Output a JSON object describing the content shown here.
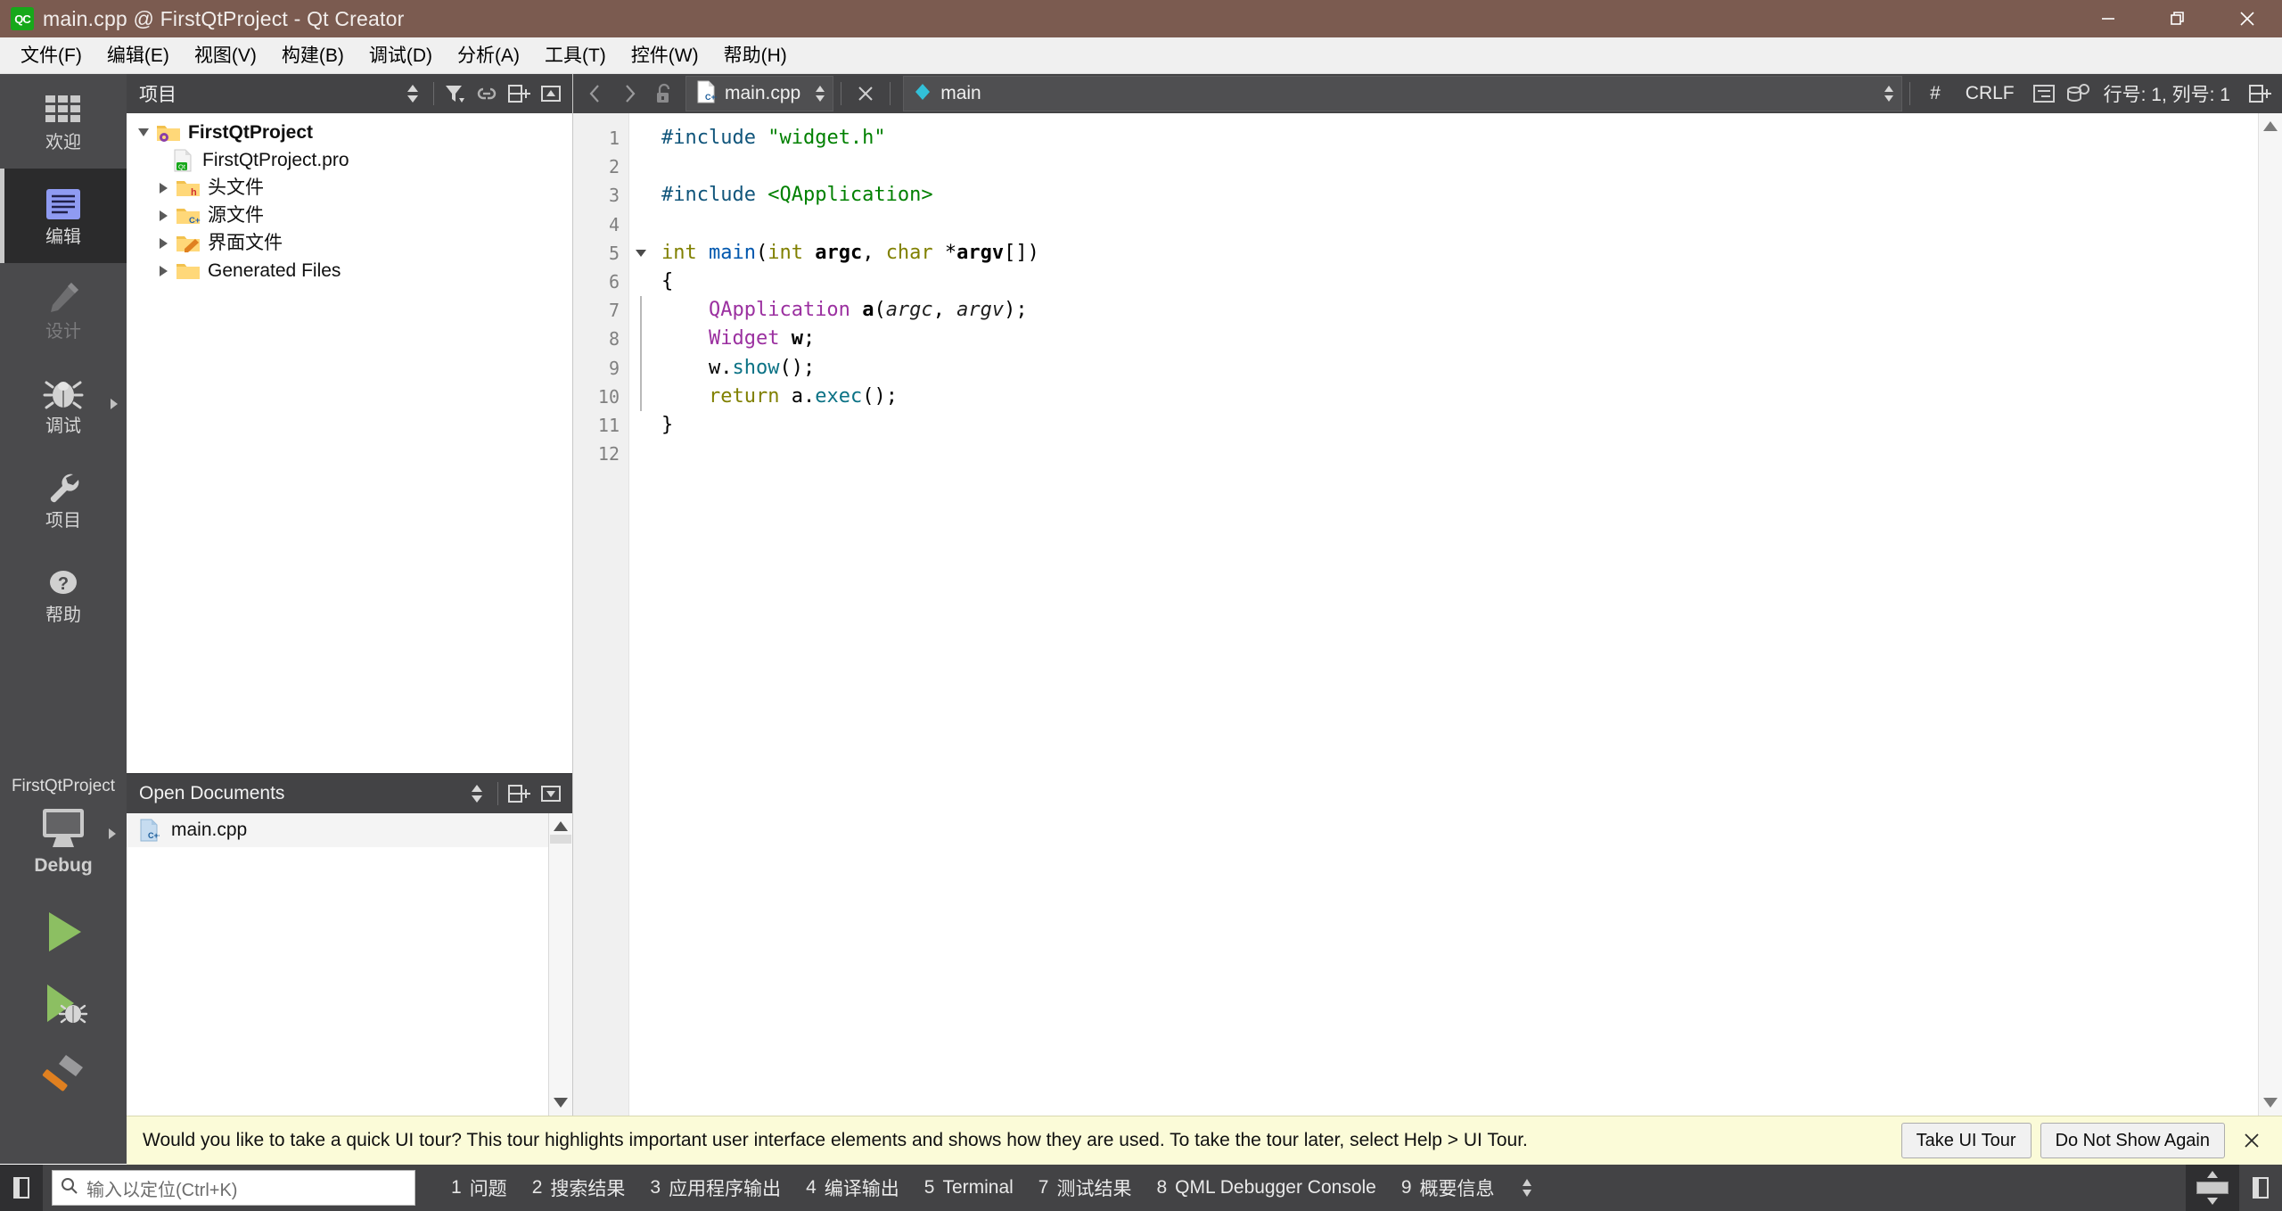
{
  "window": {
    "logo_text": "QC",
    "title": "main.cpp @ FirstQtProject - Qt Creator",
    "controls": {
      "minimize": "minimize-icon",
      "restore": "restore-icon",
      "close": "close-icon"
    },
    "titlebar_color": "#7b5b50"
  },
  "menubar": {
    "items": [
      {
        "label": "文件(F)"
      },
      {
        "label": "编辑(E)"
      },
      {
        "label": "视图(V)"
      },
      {
        "label": "构建(B)"
      },
      {
        "label": "调试(D)"
      },
      {
        "label": "分析(A)"
      },
      {
        "label": "工具(T)"
      },
      {
        "label": "控件(W)"
      },
      {
        "label": "帮助(H)"
      }
    ]
  },
  "modebar": {
    "items": [
      {
        "label": "欢迎",
        "icon": "grid-icon",
        "state": "normal"
      },
      {
        "label": "编辑",
        "icon": "document-lines-icon",
        "state": "active"
      },
      {
        "label": "设计",
        "icon": "pencil-icon",
        "state": "disabled"
      },
      {
        "label": "调试",
        "icon": "bug-icon",
        "state": "normal",
        "has_arrow": true
      },
      {
        "label": "项目",
        "icon": "wrench-icon",
        "state": "normal"
      },
      {
        "label": "帮助",
        "icon": "question-circle-icon",
        "state": "normal"
      }
    ],
    "kit": {
      "project_name": "FirstQtProject",
      "target_icon": "monitor-icon",
      "build_config": "Debug"
    },
    "actions": [
      {
        "name": "run-button",
        "icon": "play-icon",
        "color": "#8cbf62"
      },
      {
        "name": "debug-button",
        "icon": "play-bug-icon",
        "color": "#8cbf62"
      },
      {
        "name": "build-button",
        "icon": "hammer-icon",
        "color": "#e08020"
      }
    ]
  },
  "project_panel": {
    "title": "项目",
    "toolbar": [
      "updown-arrows-icon",
      "filter-icon",
      "link-icon",
      "split-add-icon",
      "collapse-icon"
    ],
    "tree": [
      {
        "label": "FirstQtProject",
        "icon": "folder-project-icon",
        "indent": 0,
        "twist": "open",
        "bold": true
      },
      {
        "label": "FirstQtProject.pro",
        "icon": "qt-file-icon",
        "indent": 1,
        "twist": "none",
        "bold": false
      },
      {
        "label": "头文件",
        "icon": "folder-h-icon",
        "indent": 1,
        "twist": "closed",
        "bold": false
      },
      {
        "label": "源文件",
        "icon": "folder-cpp-icon",
        "indent": 1,
        "twist": "closed",
        "bold": false
      },
      {
        "label": "界面文件",
        "icon": "folder-ui-icon",
        "indent": 1,
        "twist": "closed",
        "bold": false
      },
      {
        "label": "Generated Files",
        "icon": "folder-icon",
        "indent": 1,
        "twist": "closed",
        "bold": false
      }
    ]
  },
  "open_documents": {
    "title": "Open Documents",
    "toolbar": [
      "updown-arrows-icon",
      "split-add-icon",
      "dropdown-icon"
    ],
    "items": [
      {
        "label": "main.cpp",
        "icon": "cpp-file-icon",
        "selected": true
      }
    ]
  },
  "editor": {
    "toolbar": {
      "back": "back-arrow-icon",
      "forward": "forward-arrow-icon",
      "lock": "unlock-icon",
      "file_icon": "cpp-file-icon",
      "file_name": "main.cpp",
      "file_updown": "updown-arrows-icon",
      "close": "close-x-icon",
      "symbol_icon": "diamond-icon",
      "symbol_name": "main",
      "symbol_updown": "updown-arrows-icon",
      "hash": "#",
      "line_ending": "CRLF",
      "indent_icon": "text-indent-icon",
      "db_icon": "database-icon",
      "cursor_position": "行号: 1, 列号: 1",
      "split_icon": "split-add-icon"
    },
    "line_numbers": [
      "1",
      "2",
      "3",
      "4",
      "5",
      "6",
      "7",
      "8",
      "9",
      "10",
      "11",
      "12"
    ],
    "fold_line": 5,
    "code_lines": [
      [
        {
          "t": "#include ",
          "c": "tk-pre"
        },
        {
          "t": "\"widget.h\"",
          "c": "tk-str"
        }
      ],
      [],
      [
        {
          "t": "#include ",
          "c": "tk-pre"
        },
        {
          "t": "<QApplication>",
          "c": "tk-str"
        }
      ],
      [],
      [
        {
          "t": "int ",
          "c": "tk-key"
        },
        {
          "t": "main",
          "c": "tk-fn"
        },
        {
          "t": "(",
          "c": "tk-plain"
        },
        {
          "t": "int ",
          "c": "tk-key"
        },
        {
          "t": "argc",
          "c": "tk-param"
        },
        {
          "t": ", ",
          "c": "tk-plain"
        },
        {
          "t": "char ",
          "c": "tk-key"
        },
        {
          "t": "*",
          "c": "tk-plain"
        },
        {
          "t": "argv",
          "c": "tk-param"
        },
        {
          "t": "[])",
          "c": "tk-plain"
        }
      ],
      [
        {
          "t": "{",
          "c": "tk-plain"
        }
      ],
      [
        {
          "t": "    ",
          "c": "tk-plain"
        },
        {
          "t": "QApplication",
          "c": "tk-type"
        },
        {
          "t": " ",
          "c": "tk-plain"
        },
        {
          "t": "a",
          "c": "tk-param"
        },
        {
          "t": "(",
          "c": "tk-plain"
        },
        {
          "t": "argc",
          "c": "tk-paramit"
        },
        {
          "t": ", ",
          "c": "tk-plain"
        },
        {
          "t": "argv",
          "c": "tk-paramit"
        },
        {
          "t": ");",
          "c": "tk-plain"
        }
      ],
      [
        {
          "t": "    ",
          "c": "tk-plain"
        },
        {
          "t": "Widget",
          "c": "tk-type"
        },
        {
          "t": " ",
          "c": "tk-plain"
        },
        {
          "t": "w",
          "c": "tk-param"
        },
        {
          "t": ";",
          "c": "tk-plain"
        }
      ],
      [
        {
          "t": "    w.",
          "c": "tk-plain"
        },
        {
          "t": "show",
          "c": "tk-mem"
        },
        {
          "t": "();",
          "c": "tk-plain"
        }
      ],
      [
        {
          "t": "    ",
          "c": "tk-plain"
        },
        {
          "t": "return",
          "c": "tk-key"
        },
        {
          "t": " a.",
          "c": "tk-plain"
        },
        {
          "t": "exec",
          "c": "tk-mem"
        },
        {
          "t": "();",
          "c": "tk-plain"
        }
      ],
      [
        {
          "t": "}",
          "c": "tk-plain"
        }
      ],
      []
    ]
  },
  "tour_bar": {
    "message": "Would you like to take a quick UI tour? This tour highlights important user interface elements and shows how they are used. To take the tour later, select Help > UI Tour.",
    "take_tour_label": "Take UI Tour",
    "do_not_show_label": "Do Not Show Again",
    "close_icon": "close-x-icon",
    "background": "#fbfbd8"
  },
  "statusbar": {
    "left_toggle": "sidebar-toggle-icon",
    "locator": {
      "icon": "search-icon",
      "placeholder": "输入以定位(Ctrl+K)",
      "value": ""
    },
    "panes": [
      {
        "num": "1",
        "label": "问题"
      },
      {
        "num": "2",
        "label": "搜索结果"
      },
      {
        "num": "3",
        "label": "应用程序输出"
      },
      {
        "num": "4",
        "label": "编译输出"
      },
      {
        "num": "5",
        "label": "Terminal"
      },
      {
        "num": "7",
        "label": "测试结果"
      },
      {
        "num": "8",
        "label": "QML Debugger Console"
      },
      {
        "num": "9",
        "label": "概要信息"
      }
    ],
    "spinner": "updown-arrows-icon",
    "progress_icon": "progress-bar-icon",
    "right_toggle": "output-toggle-icon"
  }
}
